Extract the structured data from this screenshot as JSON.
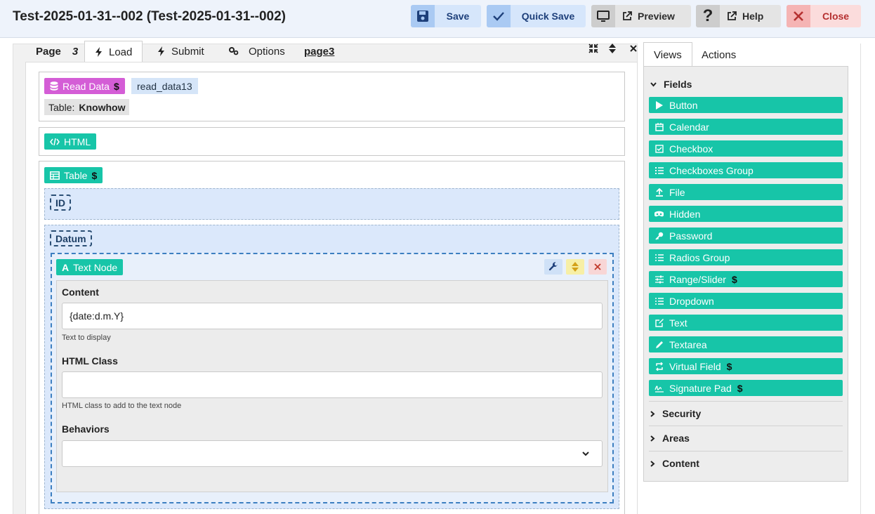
{
  "window": {
    "title": "Test-2025-01-31--002 (Test-2025-01-31--002)"
  },
  "toolbar": {
    "save": "Save",
    "quick_save": "Quick Save",
    "preview": "Preview",
    "help": "Help",
    "close": "Close"
  },
  "tabs": {
    "page_label": "Page",
    "page_number": "3",
    "load": "Load",
    "submit": "Submit",
    "options": "Options",
    "page_name": "page3"
  },
  "blocks": {
    "read_data": {
      "label": "Read Data",
      "dollar": "$",
      "name": "read_data13",
      "table_label": "Table:",
      "table_value": "Knowhow"
    },
    "html": {
      "label": "HTML"
    },
    "table": {
      "label": "Table",
      "dollar": "$",
      "col_id": "ID",
      "col_datum": "Datum"
    }
  },
  "text_node": {
    "label": "Text Node",
    "content_label": "Content",
    "content_value": "{date:d.m.Y}",
    "content_help": "Text to display",
    "class_label": "HTML Class",
    "class_value": "",
    "class_help": "HTML class to add to the text node",
    "behaviors_label": "Behaviors",
    "behaviors_value": ""
  },
  "right_panel": {
    "tabs": {
      "views": "Views",
      "actions": "Actions"
    },
    "sections": {
      "fields": "Fields",
      "security": "Security",
      "areas": "Areas",
      "content": "Content"
    },
    "fields": [
      {
        "label": "Button",
        "icon": "play-icon",
        "dollar": ""
      },
      {
        "label": "Calendar",
        "icon": "calendar-icon",
        "dollar": ""
      },
      {
        "label": "Checkbox",
        "icon": "checkbox-icon",
        "dollar": ""
      },
      {
        "label": "Checkboxes Group",
        "icon": "list-check-icon",
        "dollar": ""
      },
      {
        "label": "File",
        "icon": "upload-icon",
        "dollar": ""
      },
      {
        "label": "Hidden",
        "icon": "mask-icon",
        "dollar": ""
      },
      {
        "label": "Password",
        "icon": "key-icon",
        "dollar": ""
      },
      {
        "label": "Radios Group",
        "icon": "list-icon",
        "dollar": ""
      },
      {
        "label": "Range/Slider",
        "icon": "sliders-icon",
        "dollar": "$"
      },
      {
        "label": "Dropdown",
        "icon": "list-icon",
        "dollar": ""
      },
      {
        "label": "Text",
        "icon": "edit-icon",
        "dollar": ""
      },
      {
        "label": "Textarea",
        "icon": "pencil-icon",
        "dollar": ""
      },
      {
        "label": "Virtual Field",
        "icon": "refresh-icon",
        "dollar": "$"
      },
      {
        "label": "Signature Pad",
        "icon": "signature-icon",
        "dollar": "$"
      }
    ]
  },
  "colors": {
    "teal": "#17c5a8",
    "pink": "#d45dd6",
    "save_blue": "#1d3f7a",
    "close_red": "#b53030"
  }
}
